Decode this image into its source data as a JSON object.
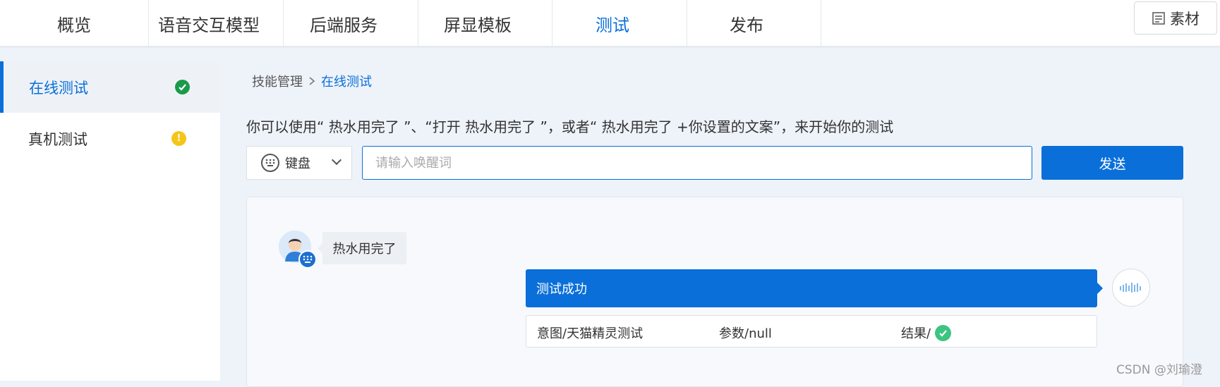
{
  "nav": {
    "tabs": [
      {
        "label": "概览"
      },
      {
        "label": "语音交互模型"
      },
      {
        "label": "后端服务"
      },
      {
        "label": "屏显模板"
      },
      {
        "label": "测试"
      },
      {
        "label": "发布"
      }
    ],
    "active_tab": "测试",
    "assets_label": "素材"
  },
  "sidebar": {
    "items": [
      {
        "label": "在线测试",
        "status": "success",
        "status_color": "#1a9a4a"
      },
      {
        "label": "真机测试",
        "status": "warning",
        "status_color": "#f5c518",
        "status_glyph": "!"
      }
    ]
  },
  "breadcrumb": {
    "parent": "技能管理",
    "current": "在线测试"
  },
  "hint_text": "你可以使用“ 热水用完了 ”、“打开 热水用完了 ”，或者“ 热水用完了 +你设置的文案”，来开始你的测试",
  "input": {
    "mode_label": "键盘",
    "placeholder": "请输入唤醒词",
    "value": "",
    "send_label": "发送"
  },
  "chat": {
    "user_message": "热水用完了",
    "result_title": "测试成功",
    "result_cells": {
      "intent": "意图/天猫精灵测试",
      "params": "参数/null",
      "result": "结果/"
    }
  },
  "watermark": "CSDN @刘瑜澄",
  "colors": {
    "accent": "#0a6fd9",
    "success": "#3cc481",
    "warning": "#f5c518"
  }
}
